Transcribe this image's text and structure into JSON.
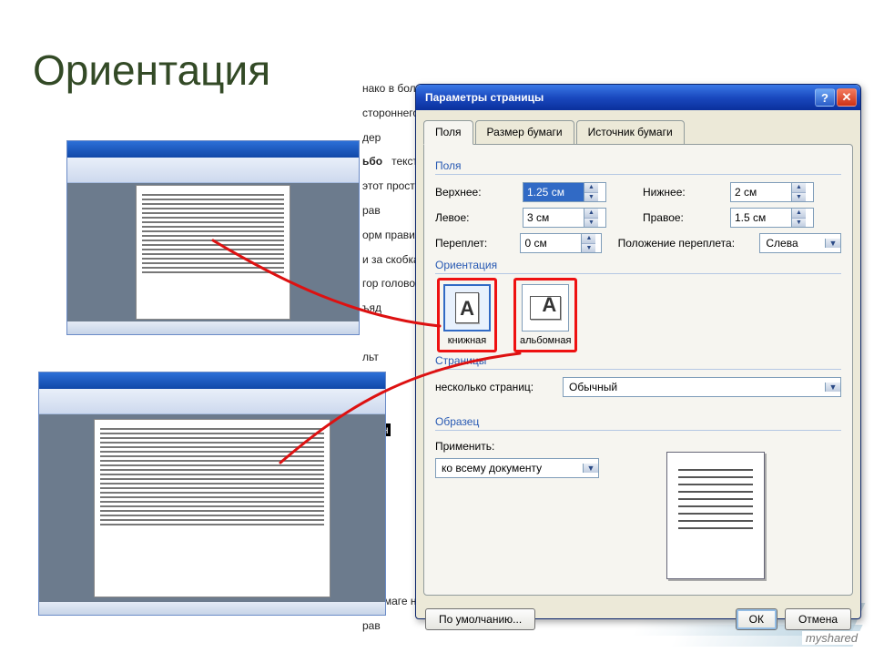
{
  "title": "Ориентация",
  "dialog": {
    "title": "Параметры страницы",
    "tabs": [
      "Поля",
      "Размер бумаги",
      "Источник бумаги"
    ],
    "active_tab": 0,
    "margins_group": "Поля",
    "top_label": "Верхнее:",
    "top_value": "1.25 см",
    "bottom_label": "Нижнее:",
    "bottom_value": "2 см",
    "left_label": "Левое:",
    "left_value": "3 см",
    "right_label": "Правое:",
    "right_value": "1.5 см",
    "gutter_label": "Переплет:",
    "gutter_value": "0 см",
    "gutter_pos_label": "Положение переплета:",
    "gutter_pos_value": "Слева",
    "orient_group": "Ориентация",
    "orient_portrait": "книжная",
    "orient_landscape": "альбомная",
    "pages_group": "Страницы",
    "multi_pages_label": "несколько страниц:",
    "multi_pages_value": "Обычный",
    "sample_group": "Образец",
    "apply_label": "Применить:",
    "apply_value": "ко всему документу",
    "btn_default": "По умолчанию...",
    "btn_ok": "ОК",
    "btn_cancel": "Отмена"
  },
  "watermark": "myshared"
}
